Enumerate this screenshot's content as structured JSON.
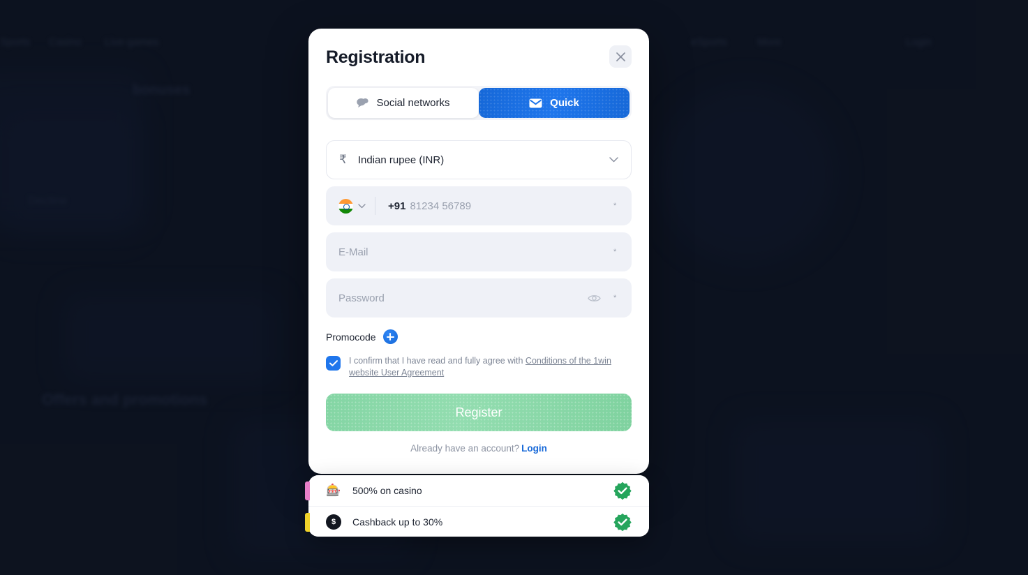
{
  "background": {
    "page_bg_color": "#101726",
    "nav_items": [
      "Sports",
      "Casino",
      "Live-games",
      "eSports",
      "More",
      "Login"
    ],
    "fragments": [
      "bonuses",
      "Decline",
      "Offers and promotions"
    ]
  },
  "modal": {
    "title": "Registration",
    "close_icon": "close-icon",
    "tabs": [
      {
        "label": "Social networks",
        "icon": "chat-bubble-icon",
        "active": false
      },
      {
        "label": "Quick",
        "icon": "envelope-icon",
        "active": true
      }
    ],
    "currency": {
      "icon": "rupee-icon",
      "value": "Indian rupee (INR)",
      "chevron_icon": "chevron-down-icon"
    },
    "phone": {
      "flag_icon": "india-flag-icon",
      "chevron_icon": "chevron-down-icon",
      "dial_code": "+91",
      "placeholder": "81234 56789",
      "value": "",
      "required_marker": "*"
    },
    "email": {
      "placeholder": "E-Mail",
      "value": "",
      "required_marker": "*"
    },
    "password": {
      "placeholder": "Password",
      "value": "",
      "eye_icon": "eye-icon",
      "required_marker": "*"
    },
    "promocode": {
      "label": "Promocode",
      "add_icon": "plus-icon"
    },
    "agreement": {
      "checked": true,
      "check_icon": "checkmark-icon",
      "text_prefix": "I confirm that I have read and fully agree with ",
      "link_text": "Conditions of the 1win website User Agreement"
    },
    "register_button": {
      "label": "Register",
      "color": "#8ad8a8"
    },
    "login_prompt": {
      "text": "Already have an account?",
      "link": "Login",
      "link_color": "#1668d8"
    }
  },
  "bonus_panel": {
    "rows": [
      {
        "icon": "slot-machine-icon",
        "glyph": "🎰",
        "label": "500% on casino",
        "accent_color": "#e87fc8",
        "status_icon": "verified-check-icon",
        "status_color": "#25a55c"
      },
      {
        "icon": "cashback-icon",
        "glyph": "$",
        "label": "Cashback up to 30%",
        "accent_color": "#f0d22a",
        "status_icon": "verified-check-icon",
        "status_color": "#25a55c"
      }
    ]
  }
}
